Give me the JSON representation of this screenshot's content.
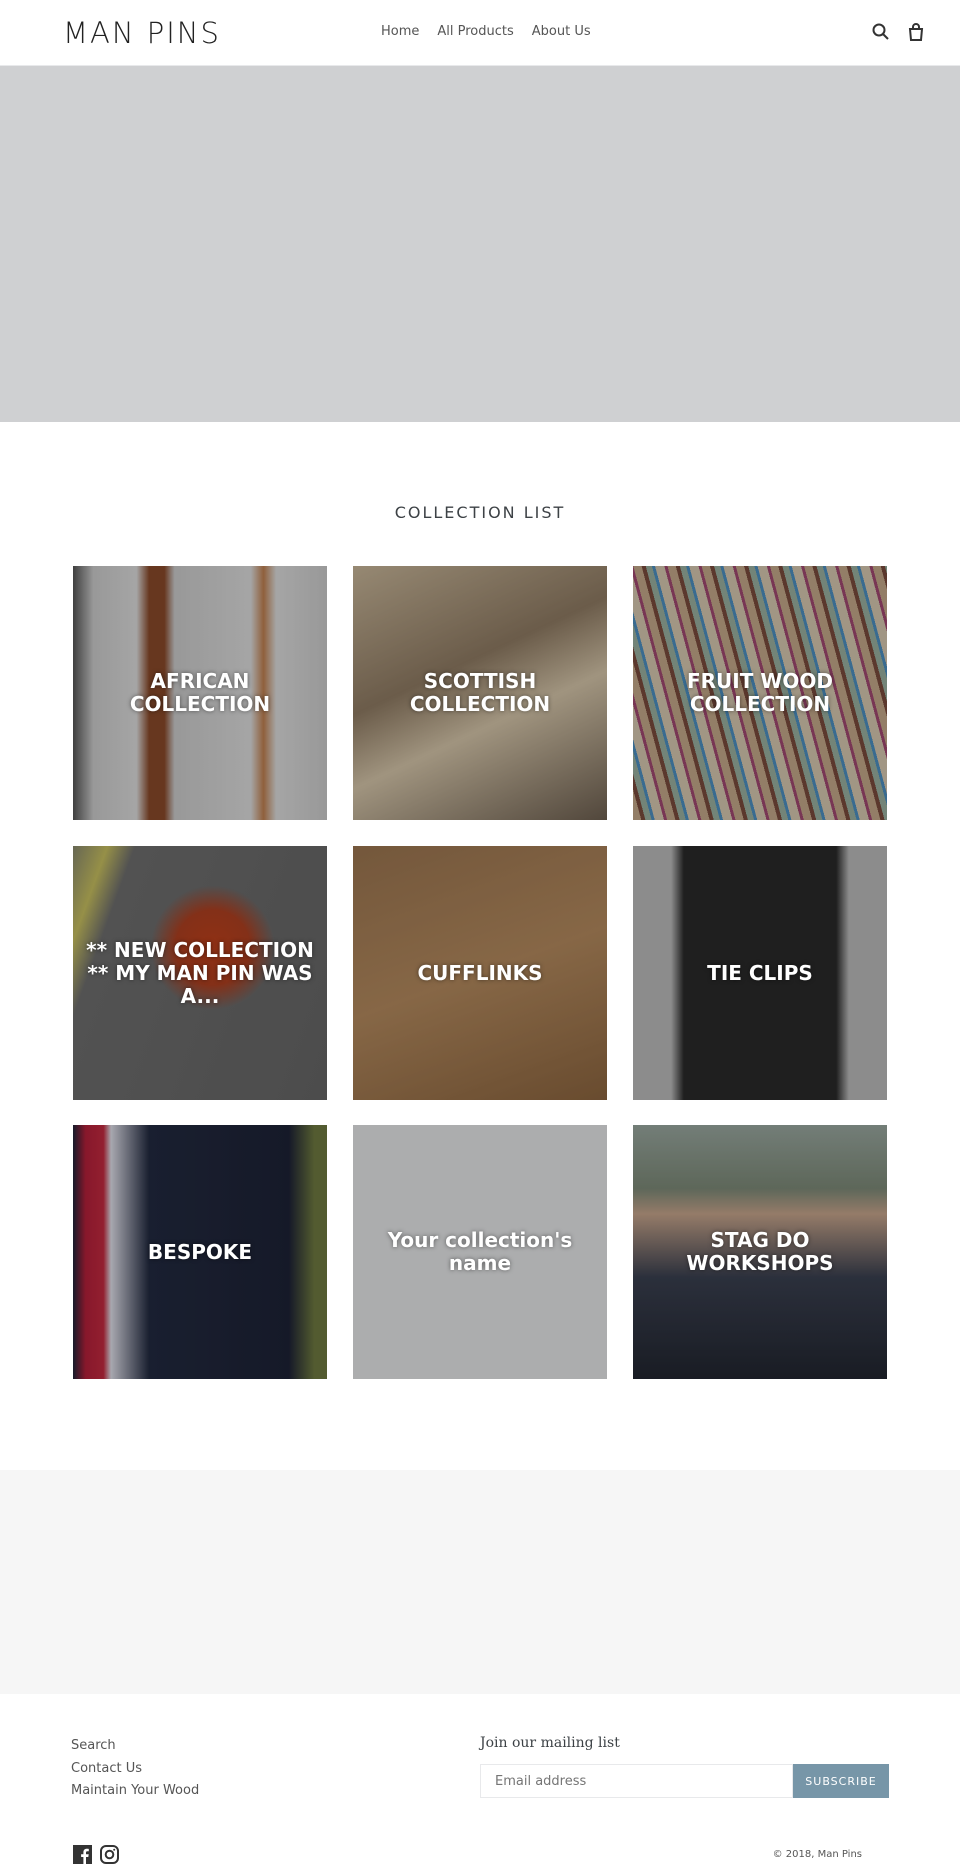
{
  "header": {
    "logo": "MAN PINS",
    "nav": [
      "Home",
      "All Products",
      "About Us"
    ],
    "icons": [
      "search-icon",
      "cart-icon"
    ]
  },
  "collection_list": {
    "title": "COLLECTION LIST",
    "items": [
      {
        "label": "AFRICAN COLLECTION"
      },
      {
        "label": "SCOTTISH COLLECTION"
      },
      {
        "label": "FRUIT WOOD COLLECTION"
      },
      {
        "label": "** NEW COLLECTION ** MY MAN PIN WAS A..."
      },
      {
        "label": "CUFFLINKS"
      },
      {
        "label": "TIE CLIPS"
      },
      {
        "label": "BESPOKE"
      },
      {
        "label": "Your collection's name"
      },
      {
        "label": "STAG DO WORKSHOPS"
      }
    ]
  },
  "footer": {
    "links": [
      "Search",
      "Contact Us",
      "Maintain Your Wood"
    ],
    "mailing_title": "Join our mailing list",
    "email_placeholder": "Email address",
    "subscribe": "SUBSCRIBE",
    "social": [
      "facebook-icon",
      "instagram-icon"
    ],
    "copyright": "© 2018, Man Pins"
  },
  "colors": {
    "accent": "#7796a8",
    "hero": "#cfd0d2"
  }
}
